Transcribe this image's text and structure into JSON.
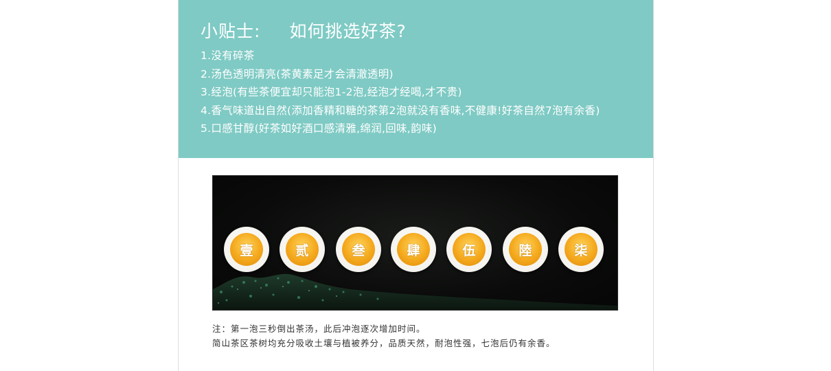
{
  "tips": {
    "label": "小贴士:",
    "question": "如何挑选好茶?",
    "items": [
      "1.没有碎茶",
      "2.汤色透明清亮(茶黄素足才会清澈透明)",
      "3.经泡(有些茶便宜却只能泡1-2泡,经泡才经喝,才不贵)",
      "4.香气味道出自然(添加香精和糖的茶第2泡就没有香味,不健康!好茶自然7泡有余香)",
      "5.口感甘醇(好茶如好酒口感清雅,绵润,回味,韵味)"
    ]
  },
  "cups": [
    "壹",
    "贰",
    "叁",
    "肆",
    "伍",
    "陸",
    "柒"
  ],
  "note": {
    "line1": "注：第一泡三秒倒出茶汤，此后冲泡逐次增加时间。",
    "line2": "简山茶区茶树均充分吸收土壤与植被养分，品质天然，耐泡性强，七泡后仍有余香。"
  },
  "colors": {
    "teal": "#7fcac4",
    "tea": "#f4a81c"
  }
}
